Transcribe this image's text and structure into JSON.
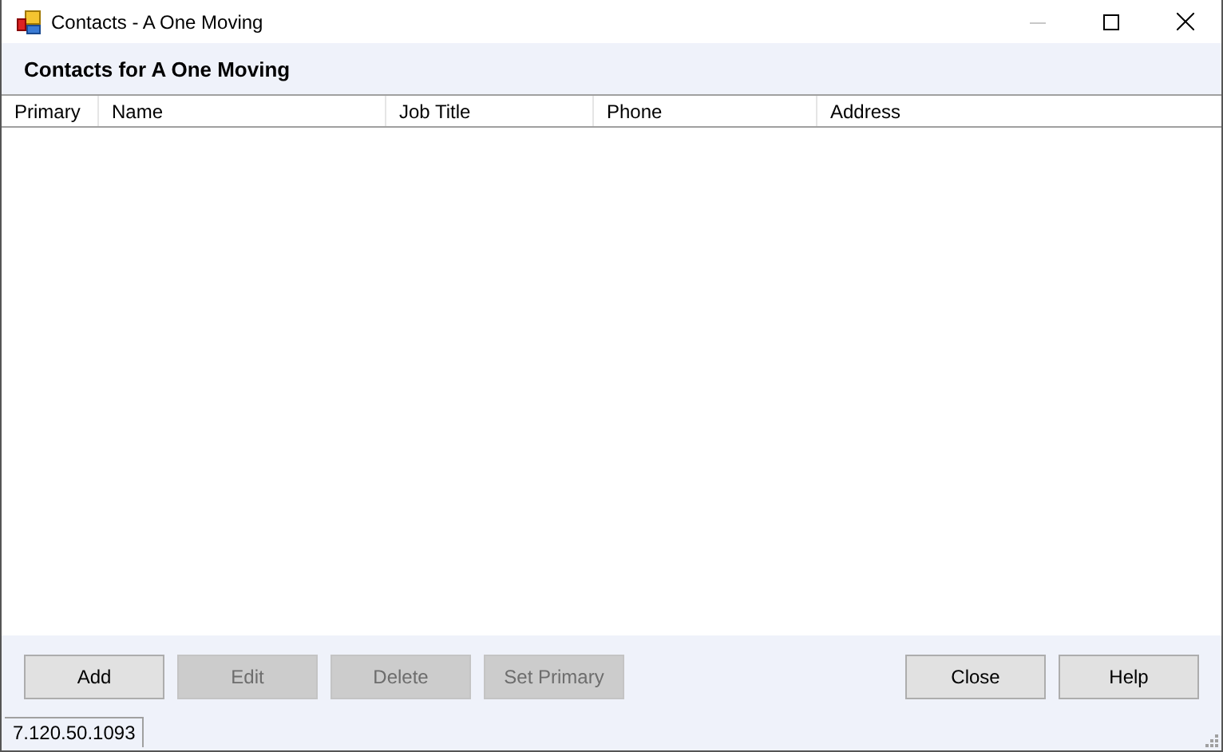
{
  "window": {
    "title": "Contacts - A One Moving"
  },
  "header": {
    "title": "Contacts for A One Moving"
  },
  "table": {
    "columns": [
      "Primary",
      "Name",
      "Job Title",
      "Phone",
      "Address"
    ]
  },
  "buttons": [
    {
      "label": "Add",
      "disabled": false
    },
    {
      "label": "Edit",
      "disabled": true
    },
    {
      "label": "Delete",
      "disabled": true
    },
    {
      "label": "Set Primary",
      "disabled": true
    }
  ],
  "right_buttons": [
    {
      "label": "Close",
      "disabled": false
    },
    {
      "label": "Help",
      "disabled": false
    }
  ],
  "status_bar": {
    "version": "7.120.50.1093"
  }
}
